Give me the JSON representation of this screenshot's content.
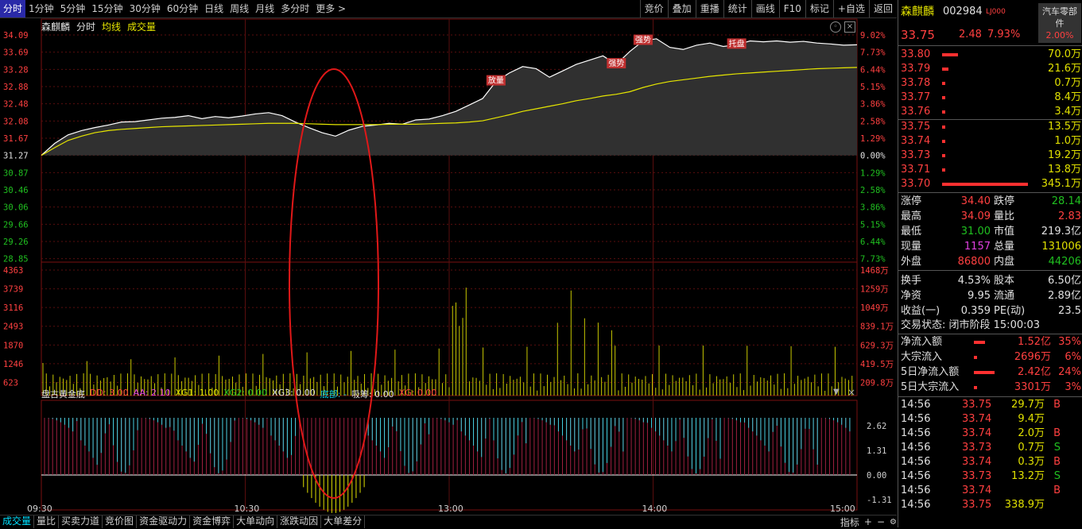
{
  "toolbar": {
    "periods": [
      "分时",
      "1分钟",
      "5分钟",
      "15分钟",
      "30分钟",
      "60分钟",
      "日线",
      "周线",
      "月线",
      "多分时",
      "更多 >"
    ],
    "active_period": "分时",
    "tools": [
      "竞价",
      "叠加",
      "重播",
      "统计",
      "画线",
      "F10",
      "标记",
      "+自选",
      "返回"
    ]
  },
  "chart_head": {
    "name": "森麒麟",
    "mode": "分时",
    "avg": "均线",
    "vol": "成交量"
  },
  "price_axis": {
    "left": [
      "34.09",
      "33.69",
      "33.28",
      "32.88",
      "32.48",
      "32.08",
      "31.67",
      "31.27",
      "30.87",
      "30.46",
      "30.06",
      "29.66",
      "29.26",
      "28.85"
    ],
    "right": [
      "9.02%",
      "7.73%",
      "6.44%",
      "5.15%",
      "3.86%",
      "2.58%",
      "1.29%",
      "0.00%",
      "1.29%",
      "2.58%",
      "3.86%",
      "5.15%",
      "6.44%",
      "7.73%"
    ]
  },
  "vol_axis": {
    "left": [
      "4363",
      "3739",
      "3116",
      "2493",
      "1870",
      "1246",
      "623"
    ],
    "right": [
      "1468万",
      "1259万",
      "1049万",
      "839.1万",
      "629.3万",
      "419.5万",
      "209.8万"
    ]
  },
  "chart_data": {
    "type": "line",
    "x": [
      "09:30",
      "10:30",
      "13:00",
      "14:00",
      "15:00"
    ],
    "price_range": [
      28.85,
      34.09
    ],
    "prev_close": 31.27,
    "price_series": [
      31.27,
      31.55,
      31.75,
      31.85,
      31.92,
      31.98,
      32.05,
      32.06,
      32.1,
      32.14,
      32.16,
      32.2,
      32.13,
      32.18,
      32.15,
      32.19,
      32.24,
      32.27,
      32.2,
      32.05,
      31.92,
      31.8,
      31.72,
      31.86,
      31.95,
      31.98,
      32.02,
      32.0,
      32.1,
      32.12,
      32.2,
      32.3,
      32.45,
      32.6,
      33.0,
      33.2,
      33.35,
      33.3,
      33.1,
      33.25,
      33.4,
      33.5,
      33.6,
      33.4,
      33.7,
      33.95,
      34.0,
      33.8,
      33.75,
      33.85,
      33.9,
      33.82,
      33.86,
      33.95,
      33.93,
      33.95,
      33.92,
      33.94,
      33.9,
      33.88,
      33.85,
      33.86
    ],
    "avg_series": [
      31.27,
      31.45,
      31.62,
      31.72,
      31.8,
      31.85,
      31.88,
      31.9,
      31.92,
      31.94,
      31.95,
      31.96,
      31.97,
      31.98,
      31.99,
      32.0,
      32.01,
      32.02,
      32.02,
      32.02,
      32.01,
      32.0,
      31.99,
      31.99,
      31.99,
      31.99,
      32.0,
      32.0,
      32.0,
      32.01,
      32.02,
      32.03,
      32.05,
      32.08,
      32.15,
      32.22,
      32.3,
      32.36,
      32.42,
      32.48,
      32.55,
      32.6,
      32.66,
      32.7,
      32.76,
      32.86,
      32.94,
      33.0,
      33.04,
      33.08,
      33.12,
      33.15,
      33.18,
      33.2,
      33.22,
      33.24,
      33.26,
      33.28,
      33.3,
      33.31,
      33.32,
      33.33
    ],
    "annotations": [
      "放量",
      "强势",
      "强势",
      "托盘"
    ],
    "vol_max": 4363
  },
  "indicator": {
    "name": "盘古黄金底",
    "dd": "DD: 3.00",
    "aa": "AA: 2.10",
    "xg1": "XG1: 1.00",
    "xg2": "XG2: 0.00",
    "xg3": "XG3: 0.00",
    "dibu": "底部: -",
    "xichou": "吸筹: 0.00",
    "xg": "XG: 0.00",
    "axis": [
      "2.62",
      "1.31",
      "0.00",
      "-1.31"
    ]
  },
  "bottom_tabs": [
    "成交量",
    "量比",
    "买卖力道",
    "竞价图",
    "资金驱动力",
    "资金博弈",
    "大单动向",
    "涨跌动因",
    "大单差分"
  ],
  "bottom_right": {
    "indicator": "指标",
    "plus": "+",
    "minus": "−"
  },
  "panel": {
    "name": "森麒麟",
    "code": "002984",
    "tag": "LJ000",
    "sector": "汽车零部件",
    "sector_chg": "2.00%",
    "price": "33.75",
    "change": "2.48",
    "pct": "7.93%",
    "asks": [
      {
        "p": "33.80",
        "v": "70.0万"
      },
      {
        "p": "33.79",
        "v": "21.6万"
      },
      {
        "p": "33.78",
        "v": "0.7万"
      },
      {
        "p": "33.77",
        "v": "8.4万"
      },
      {
        "p": "33.76",
        "v": "3.4万"
      }
    ],
    "bids": [
      {
        "p": "33.75",
        "v": "13.5万"
      },
      {
        "p": "33.74",
        "v": "1.0万"
      },
      {
        "p": "33.73",
        "v": "19.2万"
      },
      {
        "p": "33.71",
        "v": "13.8万"
      },
      {
        "p": "33.70",
        "v": "345.1万"
      }
    ],
    "stats": [
      [
        "涨停",
        "34.40",
        "跌停",
        "28.14"
      ],
      [
        "最高",
        "34.09",
        "量比",
        "2.83"
      ],
      [
        "最低",
        "31.00",
        "市值",
        "219.3亿"
      ],
      [
        "现量",
        "1157",
        "总量",
        "131006"
      ],
      [
        "外盘",
        "86800",
        "内盘",
        "44206"
      ],
      [
        "换手",
        "4.53%",
        "股本",
        "6.50亿"
      ],
      [
        "净资",
        "9.95",
        "流通",
        "2.89亿"
      ],
      [
        "收益(一)",
        "0.359",
        "PE(动)",
        "23.5"
      ]
    ],
    "status": "交易状态: 闭市阶段 15:00:03",
    "flows": [
      [
        "净流入额",
        "1.52亿",
        "35%"
      ],
      [
        "大宗流入",
        "2696万",
        "6%"
      ],
      [
        "5日净流入额",
        "2.42亿",
        "24%"
      ],
      [
        "5日大宗流入",
        "3301万",
        "3%"
      ]
    ],
    "ticks": [
      [
        "14:56",
        "33.75",
        "29.7万",
        "B"
      ],
      [
        "14:56",
        "33.74",
        "9.4万",
        ""
      ],
      [
        "14:56",
        "33.74",
        "2.0万",
        "B"
      ],
      [
        "14:56",
        "33.73",
        "0.7万",
        "S"
      ],
      [
        "14:56",
        "33.74",
        "0.3万",
        "B"
      ],
      [
        "14:56",
        "33.73",
        "13.2万",
        "S"
      ],
      [
        "14:56",
        "33.74",
        "",
        "B"
      ],
      [
        "14:56",
        "33.75",
        "338.9万",
        ""
      ]
    ]
  }
}
